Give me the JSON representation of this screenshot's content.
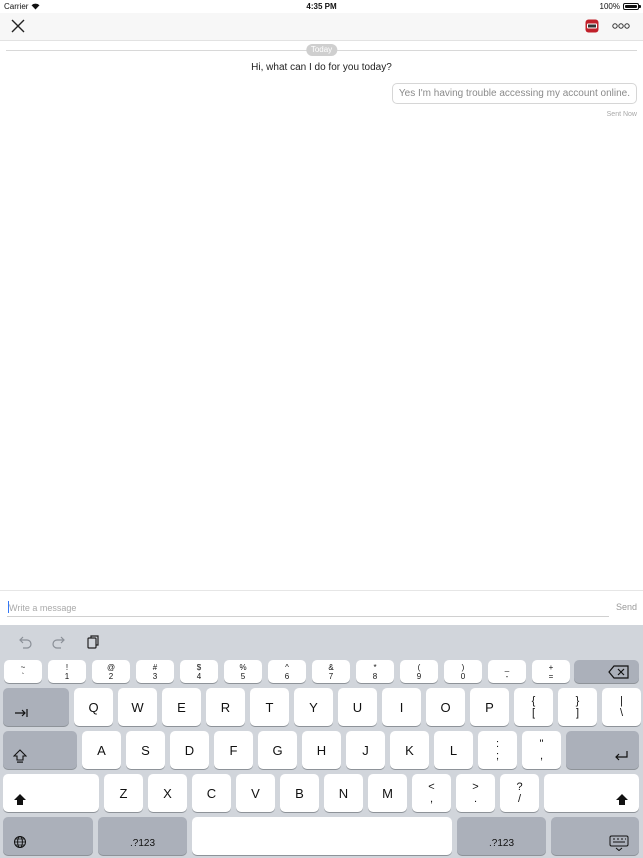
{
  "status_bar": {
    "carrier": "Carrier",
    "time": "4:35 PM",
    "battery": "100%",
    "battery_level": 1.0
  },
  "navbar": {
    "close_icon": "close-icon",
    "app_icon": "app-badge-icon",
    "more_icon": "more-icon"
  },
  "chat": {
    "date_divider": "Today",
    "messages": [
      {
        "from": "bot",
        "text": "Hi, what can I do for you today?"
      },
      {
        "from": "user",
        "text": "Yes I'm having trouble accessing my account online.",
        "status": "Sent  Now"
      }
    ]
  },
  "composer": {
    "placeholder": "Write a message",
    "send_label": "Send"
  },
  "keyboard": {
    "toolbar": [
      "undo-icon",
      "redo-icon",
      "paste-icon"
    ],
    "number_row": [
      {
        "top": "~",
        "bottom": "`"
      },
      {
        "top": "!",
        "bottom": "1"
      },
      {
        "top": "@",
        "bottom": "2"
      },
      {
        "top": "#",
        "bottom": "3"
      },
      {
        "top": "$",
        "bottom": "4"
      },
      {
        "top": "%",
        "bottom": "5"
      },
      {
        "top": "^",
        "bottom": "6"
      },
      {
        "top": "&",
        "bottom": "7"
      },
      {
        "top": "*",
        "bottom": "8"
      },
      {
        "top": "(",
        "bottom": "9"
      },
      {
        "top": ")",
        "bottom": "0"
      },
      {
        "top": "_",
        "bottom": "-"
      },
      {
        "top": "+",
        "bottom": "="
      }
    ],
    "row1": [
      "Q",
      "W",
      "E",
      "R",
      "T",
      "Y",
      "U",
      "I",
      "O",
      "P"
    ],
    "row1_symbols": [
      {
        "top": "{",
        "bottom": "["
      },
      {
        "top": "}",
        "bottom": "]"
      },
      {
        "top": "|",
        "bottom": "\\"
      }
    ],
    "row2": [
      "A",
      "S",
      "D",
      "F",
      "G",
      "H",
      "J",
      "K",
      "L"
    ],
    "row2_symbols": [
      {
        "top": ":",
        "bottom": ";"
      },
      {
        "top": "\"",
        "bottom": ","
      }
    ],
    "row3": [
      "Z",
      "X",
      "C",
      "V",
      "B",
      "N",
      "M"
    ],
    "row3_symbols": [
      {
        "top": "<",
        "bottom": ","
      },
      {
        "top": ">",
        "bottom": "."
      },
      {
        "top": "?",
        "bottom": "/"
      }
    ],
    "numbers_label": ".?123"
  }
}
